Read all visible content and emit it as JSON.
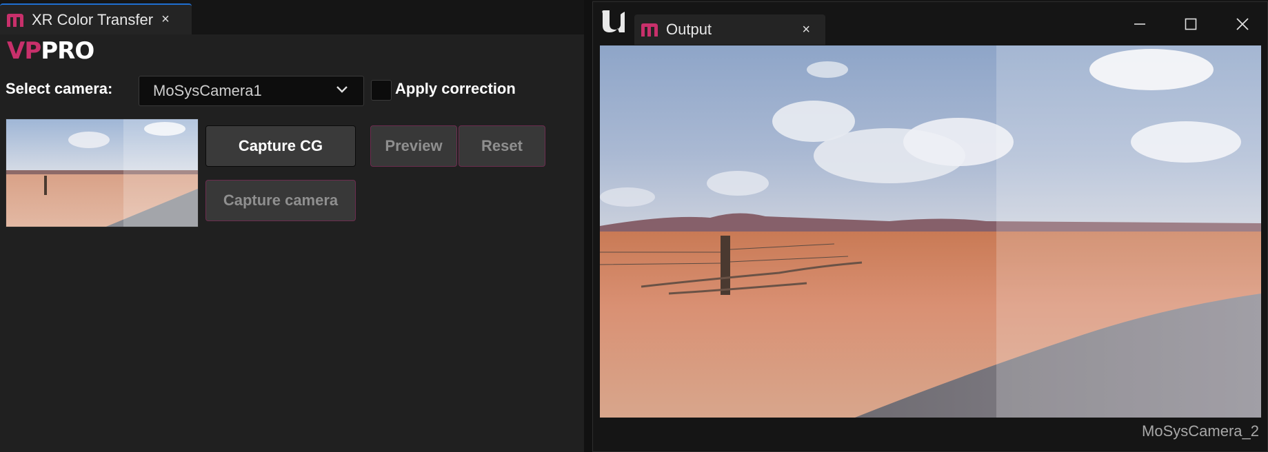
{
  "left_tab": {
    "title": "XR Color Transfer",
    "close_glyph": "×",
    "icon": "m-logo-icon"
  },
  "brand": {
    "vp": "VP",
    "pro": "PRO"
  },
  "camera_select": {
    "label": "Select camera:",
    "value": "MoSysCamera1",
    "icon": "chevron-down-icon"
  },
  "apply_correction": {
    "label": "Apply correction",
    "checked": false
  },
  "buttons": {
    "capture_cg": "Capture CG",
    "preview": "Preview",
    "reset": "Reset",
    "capture_camera": "Capture camera"
  },
  "output_window": {
    "tab_title": "Output",
    "close_glyph": "×",
    "camera_name": "MoSysCamera_2",
    "controls": [
      "minimize-icon",
      "maximize-icon",
      "close-icon"
    ]
  },
  "colors": {
    "accent_magenta": "#c8306b",
    "tab_accent_blue": "#1f6fd1",
    "panel_bg": "#202020",
    "disabled_border": "#6d2c4f"
  }
}
